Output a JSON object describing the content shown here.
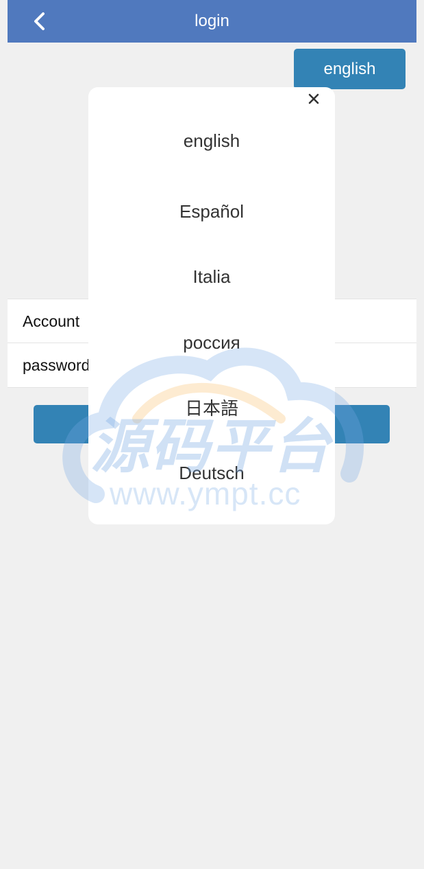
{
  "header": {
    "title": "login",
    "back_icon": "chevron-left-icon"
  },
  "language_button": {
    "label": "english"
  },
  "form": {
    "account_label": "Account",
    "password_label": "password"
  },
  "language_popup": {
    "close_icon": "close-icon",
    "options": [
      "english",
      "Español",
      "Italia",
      "россия",
      "日本語",
      "Deutsch"
    ]
  },
  "watermark": {
    "title": "源码平台",
    "url": "www.ympt.cc"
  },
  "colors": {
    "header": "#5079be",
    "accent_button": "#3383b5",
    "page_background": "#f0f0f0",
    "popup_background": "#ffffff"
  }
}
